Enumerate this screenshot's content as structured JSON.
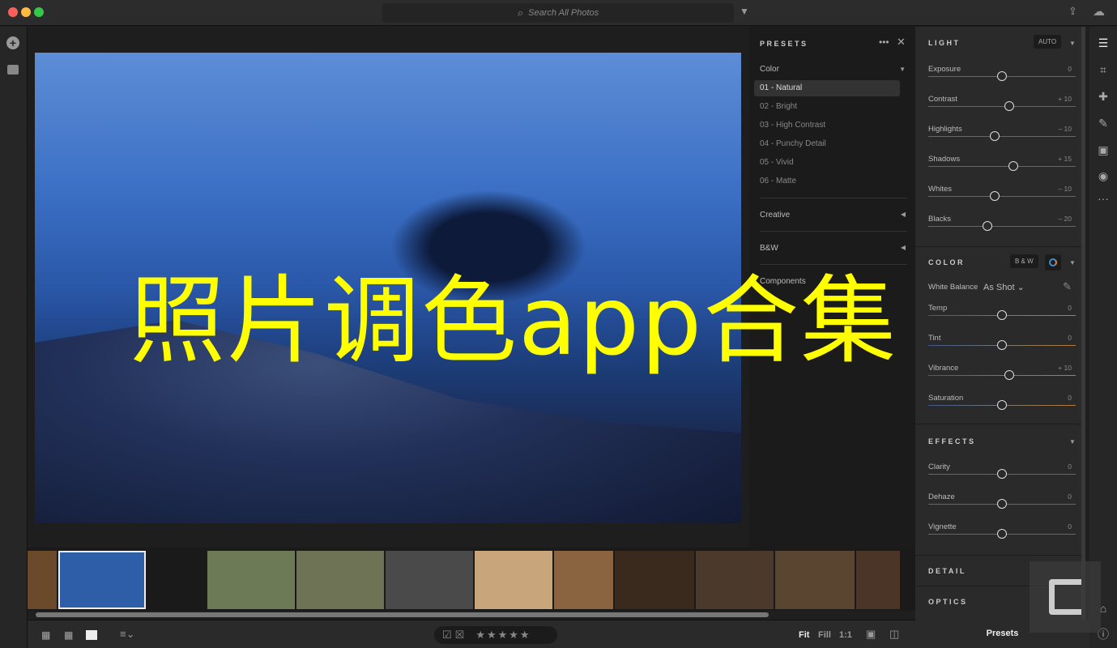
{
  "titlebar": {
    "search_placeholder": "Search All Photos"
  },
  "overlay_text": "照片调色app合集",
  "presets": {
    "title": "PRESETS",
    "groups": [
      {
        "label": "Color",
        "expanded": true,
        "items": [
          "01 - Natural",
          "02 - Bright",
          "03 - High Contrast",
          "04 - Punchy Detail",
          "05 - Vivid",
          "06 - Matte"
        ],
        "selected": "01 - Natural"
      },
      {
        "label": "Creative"
      },
      {
        "label": "B&W"
      },
      {
        "label": "Components"
      }
    ]
  },
  "edit": {
    "light": {
      "title": "LIGHT",
      "auto_label": "AUTO",
      "sliders": [
        {
          "label": "Exposure",
          "value": 0,
          "display": "0"
        },
        {
          "label": "Contrast",
          "value": 10,
          "display": "+ 10"
        },
        {
          "label": "Highlights",
          "value": -10,
          "display": "– 10"
        },
        {
          "label": "Shadows",
          "value": 15,
          "display": "+ 15"
        },
        {
          "label": "Whites",
          "value": -10,
          "display": "– 10"
        },
        {
          "label": "Blacks",
          "value": -20,
          "display": "– 20"
        }
      ]
    },
    "color": {
      "title": "COLOR",
      "bw_label": "B & W",
      "wb_label": "White Balance",
      "wb_value": "As Shot",
      "sliders": [
        {
          "label": "Temp",
          "value": 0,
          "display": "0"
        },
        {
          "label": "Tint",
          "value": 0,
          "display": "0"
        },
        {
          "label": "Vibrance",
          "value": 10,
          "display": "+ 10"
        },
        {
          "label": "Saturation",
          "value": 0,
          "display": "0"
        }
      ]
    },
    "effects": {
      "title": "EFFECTS",
      "sliders": [
        {
          "label": "Clarity",
          "value": 0,
          "display": "0"
        },
        {
          "label": "Dehaze",
          "value": 0,
          "display": "0"
        },
        {
          "label": "Vignette",
          "value": 0,
          "display": "0"
        }
      ]
    },
    "detail_title": "DETAIL",
    "optics_title": "OPTICS"
  },
  "filmstrip": {
    "thumb_colors": [
      "#6b4a2c",
      "#2f5ea8",
      "#1a1a1a",
      "#6c7a55",
      "#6f7356",
      "#4a4a4a",
      "#c9a57b",
      "#8a6440",
      "#3a2a1e",
      "#4b3a2c",
      "#5a4630",
      "#4a3526"
    ]
  },
  "bottombar": {
    "rating_stars": "★★★★★",
    "zoom_fit": "Fit",
    "zoom_fill": "Fill",
    "zoom_1to1": "1:1",
    "presets_label": "Presets"
  }
}
